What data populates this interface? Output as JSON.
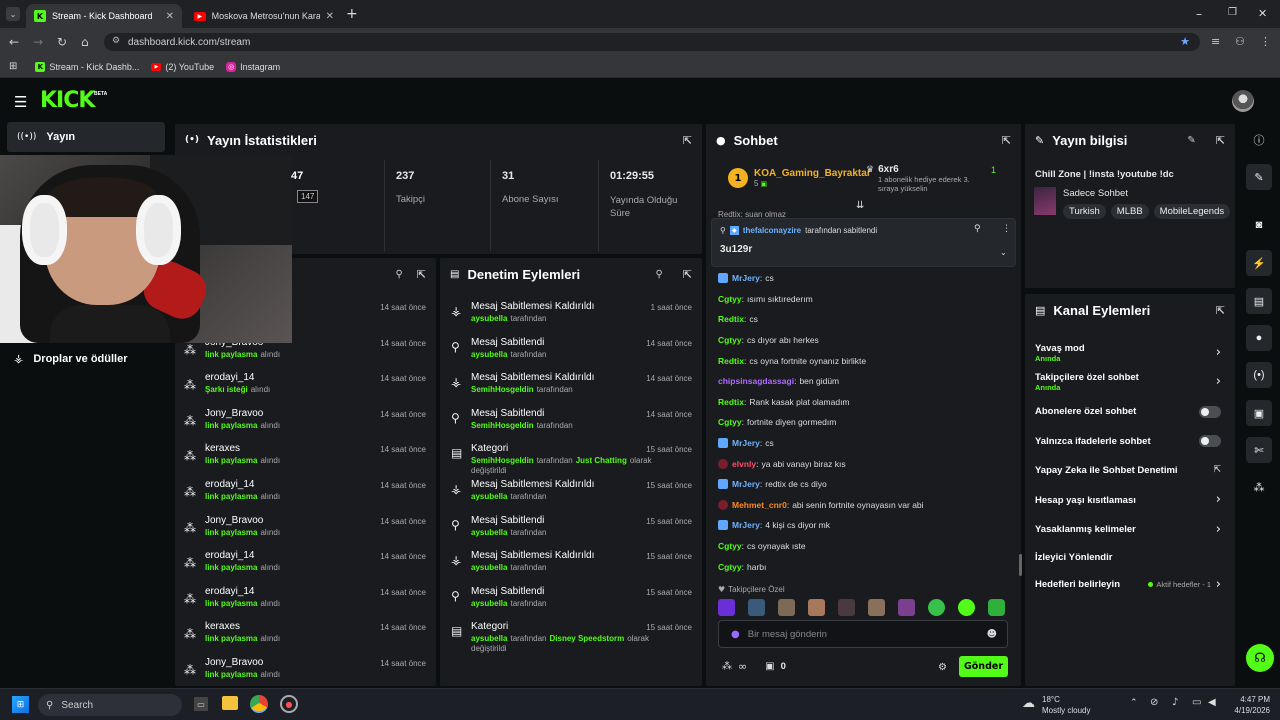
{
  "browser": {
    "tabs": [
      {
        "label": "Stream - Kick Dashboard",
        "active": true
      },
      {
        "label": "Moskova Metrosu'nun Karanlık",
        "active": false
      }
    ],
    "url": "dashboard.kick.com/stream",
    "bookmarks": [
      "Stream - Kick Dashb...",
      "(2) YouTube",
      "Instagram"
    ]
  },
  "app": {
    "logo": "KICK",
    "logo_badge": "BETA",
    "sidebar": {
      "items": [
        {
          "label": "Yayın",
          "icon": "broadcast-icon"
        },
        {
          "label": "Droplar ve ödüller",
          "icon": "gift-icon"
        }
      ]
    }
  },
  "stats": {
    "title": "Yayın İstatistikleri",
    "viewers": "147",
    "viewers_tooltip": "147",
    "items": [
      {
        "value": "237",
        "label": "Takipçi"
      },
      {
        "value": "31",
        "label": "Abone Sayısı"
      },
      {
        "value": "01:29:55",
        "label": "Yayında Olduğu Süre"
      }
    ]
  },
  "activity": {
    "rows": [
      {
        "user": "",
        "action": "",
        "time": "14 saat önce"
      },
      {
        "user": "Jony_Bravoo",
        "action": "link paylasma",
        "suffix": "alındı",
        "time": "14 saat önce"
      },
      {
        "user": "erodayi_14",
        "action": "Şarkı isteği",
        "suffix": "alındı",
        "time": "14 saat önce"
      },
      {
        "user": "Jony_Bravoo",
        "action": "link paylasma",
        "suffix": "alındı",
        "time": "14 saat önce"
      },
      {
        "user": "keraxes",
        "action": "link paylasma",
        "suffix": "alındı",
        "time": "14 saat önce"
      },
      {
        "user": "erodayi_14",
        "action": "link paylasma",
        "suffix": "alındı",
        "time": "14 saat önce"
      },
      {
        "user": "Jony_Bravoo",
        "action": "link paylasma",
        "suffix": "alındı",
        "time": "14 saat önce"
      },
      {
        "user": "erodayi_14",
        "action": "link paylasma",
        "suffix": "alındı",
        "time": "14 saat önce"
      },
      {
        "user": "erodayi_14",
        "action": "link paylasma",
        "suffix": "alındı",
        "time": "14 saat önce"
      },
      {
        "user": "keraxes",
        "action": "link paylasma",
        "suffix": "alındı",
        "time": "14 saat önce"
      },
      {
        "user": "Jony_Bravoo",
        "action": "link paylasma",
        "suffix": "alındı",
        "time": "14 saat önce"
      }
    ]
  },
  "moderation": {
    "title": "Denetim Eylemleri",
    "rows": [
      {
        "title": "Mesaj Sabitlemesi Kaldırıldı",
        "by": "aysubella",
        "rest": "tarafından",
        "time": "1 saat önce",
        "icon": "unpin-icon"
      },
      {
        "title": "Mesaj Sabitlendi",
        "by": "aysubella",
        "rest": "tarafından",
        "time": "14 saat önce",
        "icon": "pin-icon"
      },
      {
        "title": "Mesaj Sabitlemesi Kaldırıldı",
        "by": "SemihHosgeldin",
        "rest": "tarafından",
        "time": "14 saat önce",
        "icon": "unpin-icon"
      },
      {
        "title": "Mesaj Sabitlendi",
        "by": "SemihHosgeldin",
        "rest": "tarafından",
        "time": "14 saat önce",
        "icon": "pin-icon"
      },
      {
        "title": "Kategori",
        "by": "SemihHosgeldin",
        "rest": "tarafından",
        "cat": "Just Chatting",
        "tail": "olarak",
        "line2": "değiştirildi",
        "time": "15 saat önce",
        "icon": "category-icon"
      },
      {
        "title": "Mesaj Sabitlemesi Kaldırıldı",
        "by": "aysubella",
        "rest": "tarafından",
        "time": "15 saat önce",
        "icon": "unpin-icon"
      },
      {
        "title": "Mesaj Sabitlendi",
        "by": "aysubella",
        "rest": "tarafından",
        "time": "15 saat önce",
        "icon": "pin-icon"
      },
      {
        "title": "Mesaj Sabitlemesi Kaldırıldı",
        "by": "aysubella",
        "rest": "tarafından",
        "time": "15 saat önce",
        "icon": "unpin-icon"
      },
      {
        "title": "Mesaj Sabitlendi",
        "by": "aysubella",
        "rest": "tarafından",
        "time": "15 saat önce",
        "icon": "pin-icon"
      },
      {
        "title": "Kategori",
        "by": "aysubella",
        "rest": "tarafından",
        "cat": "Disney Speedstorm",
        "tail": "olarak",
        "line2": "değiştirildi",
        "time": "15 saat önce",
        "icon": "category-icon"
      }
    ]
  },
  "chat": {
    "title": "Sohbet",
    "top_gifter": {
      "rank": "1",
      "name": "KOA_Gaming_Bayraktar",
      "count": "5"
    },
    "gift": {
      "title": "6xr6",
      "rank": "1",
      "line1": "1 abonelik hediye ederek 3.",
      "line2": "sıraya yükselin"
    },
    "partial": "Redtix: suan olmaz",
    "pinned": {
      "by": "thefalconayzire",
      "by_suffix": "tarafından sabitlendi",
      "message": "3u129r"
    },
    "messages": [
      {
        "user": "MrJery",
        "color": "#6fb3ff",
        "badge": true,
        "text": "cs"
      },
      {
        "user": "Cgtyy",
        "color": "#53fc18",
        "text": "ısımı sıktırederım"
      },
      {
        "user": "Redtix",
        "color": "#53fc18",
        "text": "cs"
      },
      {
        "user": "Cgtyy",
        "color": "#53fc18",
        "text": "cs dıyor abı herkes"
      },
      {
        "user": "Redtix",
        "color": "#53fc18",
        "text": "cs oyna fortnite oynanız birlikte"
      },
      {
        "user": "chipsinsagdassagi",
        "color": "#b06bff",
        "text": "ben gidüm"
      },
      {
        "user": "Redtix",
        "color": "#53fc18",
        "text": "Rank kasak plat olamadım"
      },
      {
        "user": "Cgtyy",
        "color": "#53fc18",
        "text": "fortnite diyen gormedım"
      },
      {
        "user": "MrJery",
        "color": "#6fb3ff",
        "badge": true,
        "text": "cs"
      },
      {
        "user": "elvnly",
        "color": "#ff4d6a",
        "badge2": true,
        "text": "ya abi vanayı biraz kıs"
      },
      {
        "user": "MrJery",
        "color": "#6fb3ff",
        "badge": true,
        "text": "redtix de cs diyo"
      },
      {
        "user": "Mehmet_cnr0",
        "color": "#ff8a1f",
        "badge2": true,
        "text": "abi senin fortnite oynayasın var abi"
      },
      {
        "user": "MrJery",
        "color": "#6fb3ff",
        "badge": true,
        "text": "4 kişi cs diyor mk"
      },
      {
        "user": "Cgtyy",
        "color": "#53fc18",
        "text": "cs oynayak ıste"
      },
      {
        "user": "Cgtyy",
        "color": "#53fc18",
        "text": "harbı"
      }
    ],
    "followers_only": "Takipçilere Özel",
    "input_placeholder": "Bir mesaj gönderin",
    "counter": "0",
    "send": "Gönder"
  },
  "info": {
    "title": "Yayın bilgisi",
    "stream_title": "Chill Zone | !insta !youtube !dc",
    "category": "Sadece Sohbet",
    "tags": [
      "Turkish",
      "MLBB",
      "MobileLegends"
    ]
  },
  "channel": {
    "title": "Kanal Eylemleri",
    "rows": [
      {
        "label": "Yavaş mod",
        "sub": "Anında",
        "ctrl": "chevron"
      },
      {
        "label": "Takipçilere özel sohbet",
        "sub": "Anında",
        "ctrl": "chevron"
      },
      {
        "label": "Abonelere özel sohbet",
        "ctrl": "toggle"
      },
      {
        "label": "Yalnızca ifadelerle sohbet",
        "ctrl": "toggle"
      },
      {
        "label": "Yapay Zeka ile Sohbet Denetimi",
        "ctrl": "external"
      },
      {
        "label": "Hesap yaşı kısıtlaması",
        "ctrl": "chevron"
      },
      {
        "label": "Yasaklanmış kelimeler",
        "ctrl": "chevron"
      },
      {
        "label": "İzleyici Yönlendir",
        "ctrl": "none"
      },
      {
        "label": "Hedefleri belirleyin",
        "extra": "Aktif hedefler - 1",
        "ctrl": "chevron"
      }
    ]
  },
  "taskbar": {
    "search": "Search",
    "weather_temp": "18°C",
    "weather_desc": "Mostly cloudy",
    "time": "4:47 PM",
    "date": "4/19/2026"
  },
  "colors": {
    "accent": "#53fc18",
    "panel": "#191b1f",
    "bg": "#0b0e0f"
  }
}
